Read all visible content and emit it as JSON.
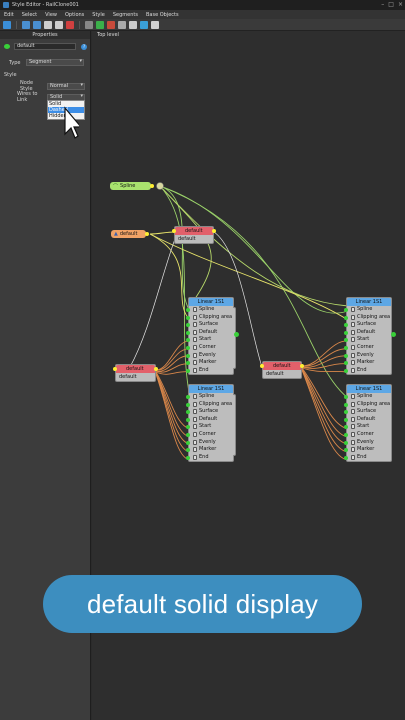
{
  "window": {
    "title": "Style Editor - RailClone001"
  },
  "menu": [
    "Edit",
    "Select",
    "View",
    "Options",
    "Style",
    "Segments",
    "Base Objects"
  ],
  "panel": {
    "header": "Properties",
    "name_value": "default",
    "type_label": "Type",
    "type_value": "Segment",
    "style_section": "Style",
    "node_style_label": "Node Style",
    "node_style_value": "Normal",
    "wires_label": "Wires to Link",
    "wires_value": "Solid",
    "wires_options": [
      "Solid",
      "Dashed",
      "Hidden"
    ],
    "highlighted_option": "Dashed"
  },
  "viewport": {
    "label": "Top level"
  },
  "nodes": {
    "spline": "Spline",
    "default_input": "default",
    "segment_top": {
      "title": "default",
      "body": "default"
    },
    "segment_left": {
      "title": "default",
      "body": "default"
    },
    "segment_mid": {
      "title": "default",
      "body": "default"
    },
    "linear_title": "Linear 1S1",
    "linear_rows": [
      "Spline",
      "Clipping area",
      "Surface",
      "Default",
      "Start",
      "Corner",
      "Evenly",
      "Marker",
      "End"
    ]
  },
  "caption": "default solid display",
  "colors": {
    "accent": "#3d8ebf",
    "segment_header": "#e2606a",
    "linear_header": "#5da7e5",
    "pin_green": "#39d039",
    "wire_green": "#9bd36a",
    "wire_orange": "#d9874a"
  }
}
